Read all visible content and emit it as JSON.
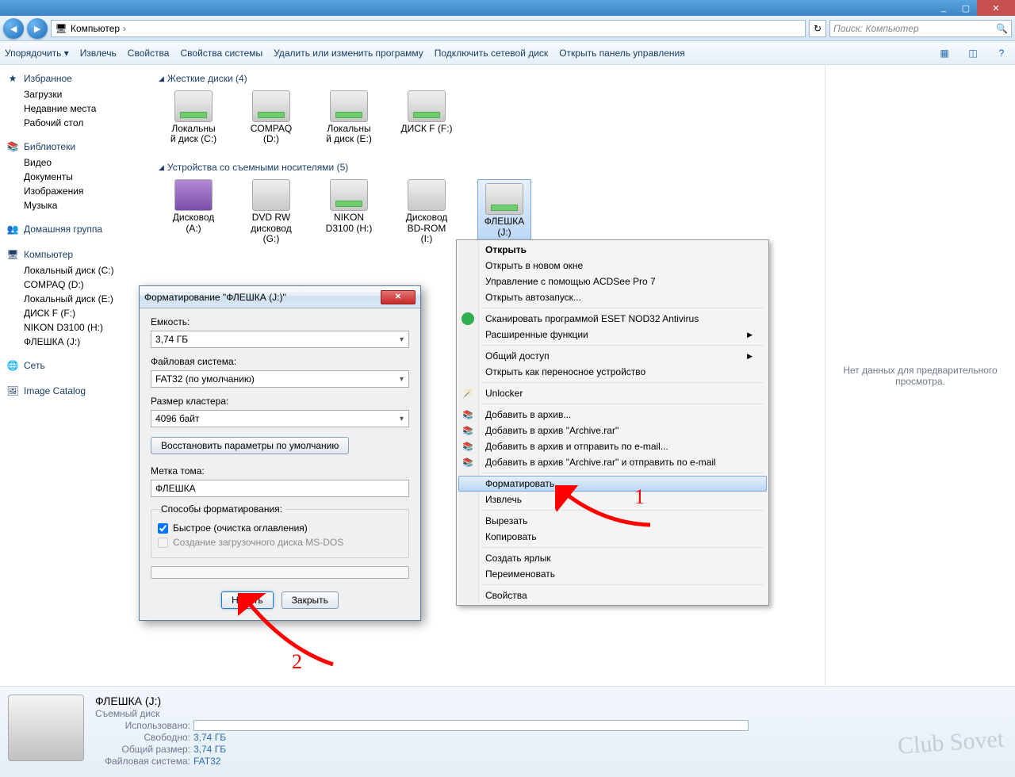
{
  "window": {
    "minimize": "_",
    "maximize": "▢",
    "close": "✕"
  },
  "nav": {
    "location": "Компьютер",
    "sep": "›",
    "search_placeholder": "Поиск: Компьютер"
  },
  "toolbar": {
    "organize": "Упорядочить ▾",
    "extract": "Извлечь",
    "properties": "Свойства",
    "system_properties": "Свойства системы",
    "uninstall": "Удалить или изменить программу",
    "map_drive": "Подключить сетевой диск",
    "control_panel": "Открыть панель управления"
  },
  "sidebar": {
    "favorites": "Избранное",
    "downloads": "Загрузки",
    "recent": "Недавние места",
    "desktop": "Рабочий стол",
    "libraries": "Библиотеки",
    "videos": "Видео",
    "documents": "Документы",
    "pictures": "Изображения",
    "music": "Музыка",
    "homegroup": "Домашняя группа",
    "computer": "Компьютер",
    "drives": [
      "Локальный диск (C:)",
      "COMPAQ (D:)",
      "Локальный диск (E:)",
      "ДИСК F (F:)",
      "NIKON D3100 (H:)",
      "ФЛЕШКА (J:)"
    ],
    "network": "Сеть",
    "imagecatalog": "Image Catalog"
  },
  "content": {
    "hdd_title": "Жесткие диски (4)",
    "hdd": [
      {
        "l1": "Локальны",
        "l2": "й диск (C:)"
      },
      {
        "l1": "COMPAQ",
        "l2": "(D:)"
      },
      {
        "l1": "Локальны",
        "l2": "й диск (E:)"
      },
      {
        "l1": "ДИСК F (F:)",
        "l2": ""
      }
    ],
    "removable_title": "Устройства со съемными носителями (5)",
    "removable": [
      {
        "l1": "Дисковод",
        "l2": "(A:)"
      },
      {
        "l1": "DVD RW",
        "l2": "дисковод",
        "l3": "(G:)"
      },
      {
        "l1": "NIKON",
        "l2": "D3100 (H:)"
      },
      {
        "l1": "Дисковод",
        "l2": "BD-ROM",
        "l3": "(I:)"
      },
      {
        "l1": "ФЛЕШКА",
        "l2": "(J:)"
      }
    ]
  },
  "preview": "Нет данных для предварительного просмотра.",
  "context": {
    "open": "Открыть",
    "open_new": "Открыть в новом окне",
    "acdsee": "Управление с помощью ACDSee Pro 7",
    "autorun": "Открыть автозапуск...",
    "eset": "Сканировать программой ESET NOD32 Antivirus",
    "advanced": "Расширенные функции",
    "share": "Общий доступ",
    "portable": "Открыть как переносное устройство",
    "unlocker": "Unlocker",
    "rar1": "Добавить в архив...",
    "rar2": "Добавить в архив \"Archive.rar\"",
    "rar3": "Добавить в архив и отправить по e-mail...",
    "rar4": "Добавить в архив \"Archive.rar\" и отправить по e-mail",
    "format": "Форматировать...",
    "eject": "Извлечь",
    "cut": "Вырезать",
    "copy": "Копировать",
    "shortcut": "Создать ярлык",
    "rename": "Переименовать",
    "props": "Свойства"
  },
  "dialog": {
    "title": "Форматирование \"ФЛЕШКА (J:)\"",
    "capacity_label": "Емкость:",
    "capacity": "3,74 ГБ",
    "fs_label": "Файловая система:",
    "fs": "FAT32 (по умолчанию)",
    "cluster_label": "Размер кластера:",
    "cluster": "4096 байт",
    "restore": "Восстановить параметры по умолчанию",
    "volume_label": "Метка тома:",
    "volume": "ФЛЕШКА",
    "methods": "Способы форматирования:",
    "quick": "Быстрое (очистка оглавления)",
    "msdos": "Создание загрузочного диска MS-DOS",
    "start": "Начать",
    "close": "Закрыть"
  },
  "details": {
    "title": "ФЛЕШКА (J:)",
    "type": "Съемный диск",
    "used_k": "Использовано:",
    "free_k": "Свободно:",
    "free_v": "3,74 ГБ",
    "total_k": "Общий размер:",
    "total_v": "3,74 ГБ",
    "fs_k": "Файловая система:",
    "fs_v": "FAT32"
  },
  "annotations": {
    "one": "1",
    "two": "2"
  },
  "watermark": "Club Sovet"
}
